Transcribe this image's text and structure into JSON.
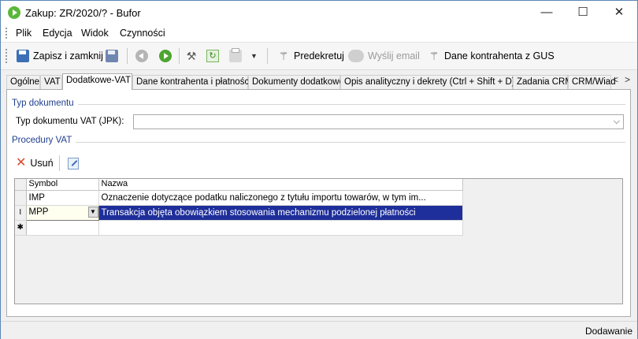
{
  "window": {
    "title": "Zakup: ZR/2020/? - Bufor",
    "minimize": "—",
    "maximize": "☐",
    "close": "✕"
  },
  "menu": [
    "Plik",
    "Edycja",
    "Widok",
    "Czynności"
  ],
  "toolbar": {
    "save_close": "Zapisz i zamknij",
    "predekretuj": "Predekretuj",
    "send_email": "Wyślij email",
    "gus": "Dane kontrahenta z GUS"
  },
  "tabs": [
    "Ogólne",
    "VAT",
    "Dodatkowe-VAT",
    "Dane kontrahenta i płatności",
    "Dokumenty dodatkowe",
    "Opis analityczny i dekrety (Ctrl + Shift + D)",
    "Zadania CRM",
    "CRM/Wiad"
  ],
  "tab_arrows": {
    "left": "<",
    "right": ">"
  },
  "doc_type": {
    "group_caption": "Typ dokumentu",
    "label": "Typ dokumentu VAT (JPK):",
    "value": "",
    "arrow": "⌵"
  },
  "procedures": {
    "group_caption": "Procedury VAT",
    "delete_label": "Usuń",
    "delete_icon": "✕",
    "columns": [
      "Symbol",
      "Nazwa"
    ],
    "rows": [
      {
        "marker": "",
        "symbol": "IMP",
        "name": "Oznaczenie dotyczące podatku naliczonego z tytułu importu towarów, w tym im..."
      },
      {
        "marker": "I",
        "symbol": "MPP",
        "name": "Transakcja objęta obowiązkiem stosowania mechanizmu podzielonej płatności",
        "selected": true
      },
      {
        "marker": "✱",
        "symbol": "",
        "name": ""
      }
    ],
    "dropdown_glyph": "▼"
  },
  "status": {
    "mode": "Dodawanie"
  }
}
